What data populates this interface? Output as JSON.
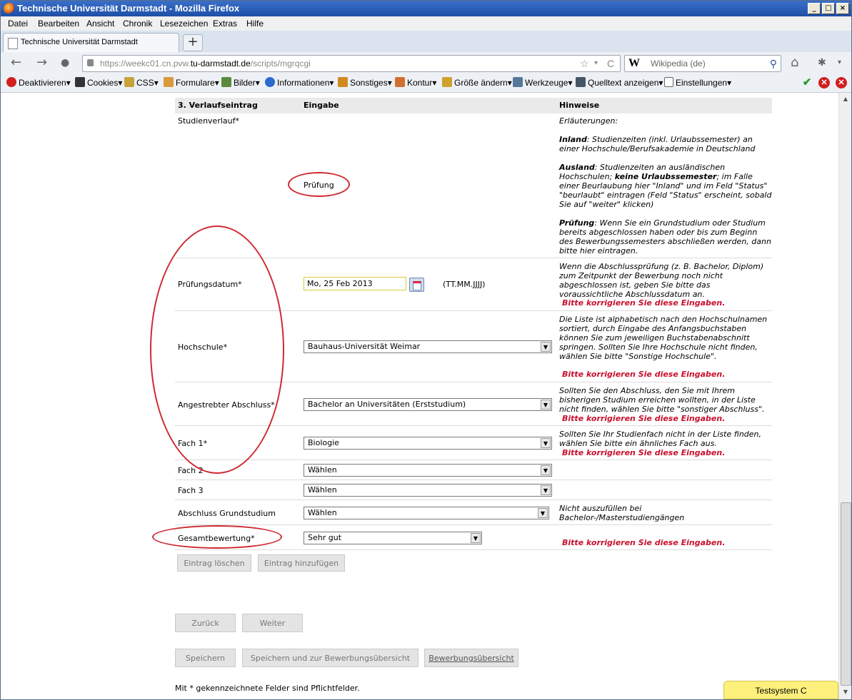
{
  "window": {
    "title": "Technische Universität Darmstadt - Mozilla Firefox",
    "min": "_",
    "max": "□",
    "close": "×"
  },
  "menu": [
    "Datei",
    "Bearbeiten",
    "Ansicht",
    "Chronik",
    "Lesezeichen",
    "Extras",
    "Hilfe"
  ],
  "tab": {
    "label": "Technische Universität Darmstadt",
    "new_tab": "+"
  },
  "nav": {
    "back": "←",
    "forward": "→",
    "home": "⌂",
    "url_prefix": "https://weekc01.cn.pvw.",
    "url_domain": "tu-darmstadt.de",
    "url_path": "/scripts/mgrqcgi",
    "star": "☆",
    "reload": "C",
    "search_engine": "W",
    "search_placeholder": "Wikipedia (de)",
    "search_icon": "⚲",
    "menu_caret": "▾"
  },
  "webdev_toolbar": [
    {
      "label": "Deaktivieren",
      "color": "#d02020"
    },
    {
      "label": "Cookies",
      "color": "#333333"
    },
    {
      "label": "CSS",
      "color": "#c8a23a"
    },
    {
      "label": "Formulare",
      "color": "#d89a3c"
    },
    {
      "label": "Bilder",
      "color": "#5a8a3c"
    },
    {
      "label": "Informationen",
      "color": "#2a6ad0"
    },
    {
      "label": "Sonstiges",
      "color": "#d08a20"
    },
    {
      "label": "Kontur",
      "color": "#d07030"
    },
    {
      "label": "Größe ändern",
      "color": "#d0a030"
    },
    {
      "label": "Werkzeuge",
      "color": "#557799"
    },
    {
      "label": "Quelltext anzeigen",
      "color": "#445566"
    },
    {
      "label": "Einstellungen",
      "color": "#666666"
    }
  ],
  "webdev_status": {
    "ok": "✔",
    "err1": "✕",
    "err2": "✕"
  },
  "form": {
    "headers": {
      "section": "3. Verlaufseintrag",
      "input": "Eingabe",
      "hints": "Hinweise"
    },
    "studienverlauf": {
      "label": "Studienverlauf*",
      "value": "Prüfung"
    },
    "hint_studienverlauf": {
      "intro": "Erläuterungen:",
      "inland_term": "Inland",
      "inland_text": ": Studienzeiten (inkl. Urlaubssemester) an einer Hochschule/Berufsakademie in Deutschland",
      "ausland_term": "Ausland",
      "ausland_text1": ": Studienzeiten an ausländischen Hochschulen; ",
      "ausland_bold": "keine Urlaubssemester",
      "ausland_text2": "; im Falle einer Beurlaubung hier \"Inland\" und im Feld \"Status\" \"beurlaubt\" eintragen (Feld \"Status\" erscheint, sobald Sie auf \"weiter\" klicken)",
      "pruefung_term": "Prüfung",
      "pruefung_text": ": Wenn Sie ein Grundstudium oder Studium bereits abgeschlossen haben oder bis zum Beginn des Bewerbungssemesters abschließen werden, dann bitte hier eintragen."
    },
    "pruefungsdatum": {
      "label": "Prüfungsdatum*",
      "value": "Mo, 25 Feb 2013",
      "format": "(TT.MM.JJJJ)",
      "hint": "Wenn die Abschlussprüfung (z. B. Bachelor, Diplom) zum Zeitpunkt der Bewerbung noch nicht abgeschlossen ist, geben Sie bitte das voraussichtliche Abschlussdatum an."
    },
    "hochschule": {
      "label": "Hochschule*",
      "value": "Bauhaus-Universität Weimar",
      "hint": "Die Liste ist alphabetisch nach den Hochschulnamen sortiert, durch Eingabe des Anfangsbuchstaben können Sie zum jeweiligen Buchstabenabschnitt springen. Sollten Sie Ihre Hochschule nicht finden, wählen Sie bitte \"Sonstige Hochschule\"."
    },
    "abschluss": {
      "label": "Angestrebter Abschluss*",
      "value": "Bachelor an Universitäten (Erststudium)",
      "hint": "Sollten Sie den Abschluss, den Sie mit Ihrem bisherigen Studium erreichen wollten, in der Liste nicht finden, wählen Sie bitte \"sonstiger Abschluss\"."
    },
    "fach1": {
      "label": "Fach 1*",
      "value": "Biologie",
      "hint": "Sollten Sie Ihr Studienfach nicht in der Liste finden, wählen Sie bitte ein ähnliches Fach aus."
    },
    "fach2": {
      "label": "Fach 2",
      "value": "Wählen"
    },
    "fach3": {
      "label": "Fach 3",
      "value": "Wählen"
    },
    "grundstudium": {
      "label": "Abschluss Grundstudium",
      "value": "Wählen",
      "hint": "Nicht auszufüllen bei Bachelor-/Masterstudiengängen"
    },
    "gesamtbewertung": {
      "label": "Gesamtbewertung*",
      "value": "Sehr gut"
    },
    "error_text": "Bitte korrigieren Sie diese Eingaben.",
    "dropdown_glyph": "▼",
    "buttons": {
      "eintrag_loeschen": "Eintrag löschen",
      "eintrag_hinzufuegen": "Eintrag hinzufügen",
      "zurueck": "Zurück",
      "weiter": "Weiter",
      "speichern": "Speichern",
      "speichern_uebersicht": "Speichern und zur Bewerbungsübersicht",
      "uebersicht": "Bewerbungsübersicht"
    },
    "footnote": "Mit * gekennzeichnete Felder sind Pflichtfelder."
  },
  "testsystem": "Testsystem C",
  "scroll": {
    "up": "▲",
    "down": "▼"
  },
  "annotation_color": "#cf2a32"
}
